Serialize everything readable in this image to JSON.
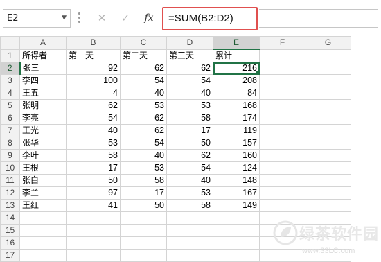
{
  "formula_bar": {
    "name_box": "E2",
    "cancel_glyph": "✕",
    "enter_glyph": "✓",
    "fx_label": "fx",
    "formula": "=SUM(B2:D2)"
  },
  "columns": [
    "A",
    "B",
    "C",
    "D",
    "E",
    "F",
    "G"
  ],
  "rows": [
    {
      "num": "1",
      "a": "所得者",
      "b": "第一天",
      "c": "第二天",
      "d": "第三天",
      "e": "累计"
    },
    {
      "num": "2",
      "a": "张三",
      "b": "92",
      "c": "62",
      "d": "62",
      "e": "216"
    },
    {
      "num": "3",
      "a": "李四",
      "b": "100",
      "c": "54",
      "d": "54",
      "e": "208"
    },
    {
      "num": "4",
      "a": "王五",
      "b": "4",
      "c": "40",
      "d": "40",
      "e": "84"
    },
    {
      "num": "5",
      "a": "张明",
      "b": "62",
      "c": "53",
      "d": "53",
      "e": "168"
    },
    {
      "num": "6",
      "a": "李亮",
      "b": "54",
      "c": "62",
      "d": "58",
      "e": "174"
    },
    {
      "num": "7",
      "a": "王光",
      "b": "40",
      "c": "62",
      "d": "17",
      "e": "119"
    },
    {
      "num": "8",
      "a": "张华",
      "b": "53",
      "c": "54",
      "d": "50",
      "e": "157"
    },
    {
      "num": "9",
      "a": "李叶",
      "b": "58",
      "c": "40",
      "d": "62",
      "e": "160"
    },
    {
      "num": "10",
      "a": "王根",
      "b": "17",
      "c": "53",
      "d": "54",
      "e": "124"
    },
    {
      "num": "11",
      "a": "张白",
      "b": "50",
      "c": "58",
      "d": "40",
      "e": "148"
    },
    {
      "num": "12",
      "a": "李兰",
      "b": "97",
      "c": "17",
      "d": "53",
      "e": "167"
    },
    {
      "num": "13",
      "a": "王红",
      "b": "41",
      "c": "50",
      "d": "58",
      "e": "149"
    },
    {
      "num": "14",
      "a": "",
      "b": "",
      "c": "",
      "d": "",
      "e": ""
    },
    {
      "num": "15",
      "a": "",
      "b": "",
      "c": "",
      "d": "",
      "e": ""
    },
    {
      "num": "16",
      "a": "",
      "b": "",
      "c": "",
      "d": "",
      "e": ""
    },
    {
      "num": "17",
      "a": "",
      "b": "",
      "c": "",
      "d": "",
      "e": ""
    }
  ],
  "watermark": {
    "name": "绿茶软件园",
    "url": "www.33LC.com"
  },
  "colors": {
    "accent": "#217346",
    "highlight_box": "#e0504f"
  }
}
